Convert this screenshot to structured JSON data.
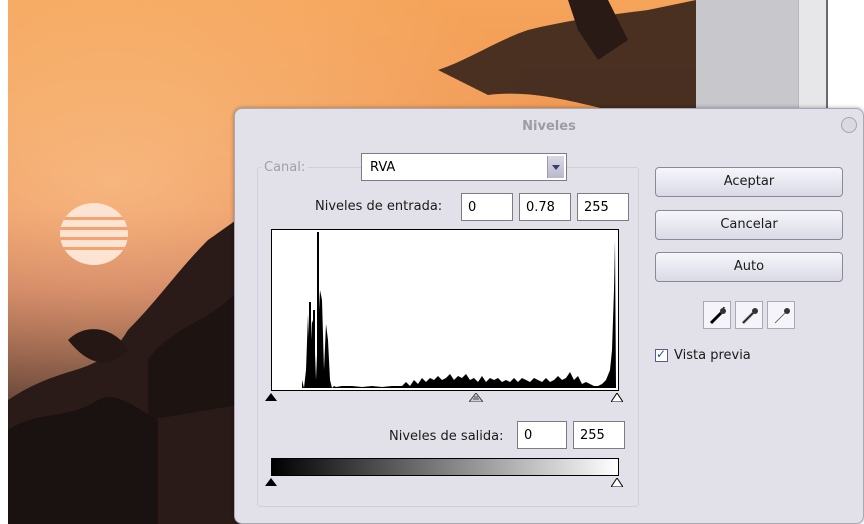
{
  "dialog": {
    "title": "Niveles",
    "channel_label": "Canal:",
    "channel_value": "RVA",
    "input_levels_label": "Niveles de entrada:",
    "input_black": "0",
    "input_gamma": "0.78",
    "input_white": "255",
    "output_levels_label": "Niveles de salida:",
    "output_black": "0",
    "output_white": "255",
    "buttons": {
      "ok": "Aceptar",
      "cancel": "Cancelar",
      "auto": "Auto"
    },
    "droppers": [
      "black-point-eyedropper-icon",
      "gray-point-eyedropper-icon",
      "white-point-eyedropper-icon"
    ],
    "preview_label": "Vista previa",
    "preview_checked": true
  },
  "colors": {
    "dialog_bg": "#e2e1e9",
    "button_gradient_top": "#f6f6fb",
    "button_gradient_bottom": "#dadae6"
  }
}
